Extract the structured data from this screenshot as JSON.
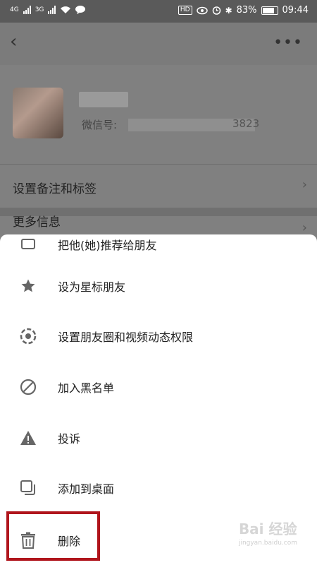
{
  "status_bar": {
    "signal1_label": "4G",
    "signal2_label": "3G",
    "hd_badge": "HD",
    "battery_percent": "83%",
    "time": "09:44"
  },
  "header": {
    "back_icon": "chevron-left-icon",
    "more_icon": "more-horizontal-icon"
  },
  "profile": {
    "wechat_id_label": "微信号:",
    "wechat_id_tail": "3823"
  },
  "rows": {
    "remark_label": "设置备注和标签",
    "partial_label": "更多信息"
  },
  "sheet": {
    "clipped_item": "把他(她)推荐给朋友",
    "items": [
      {
        "label": "设为星标朋友",
        "icon": "star-icon"
      },
      {
        "label": "设置朋友圈和视频动态权限",
        "icon": "shutter-icon"
      },
      {
        "label": "加入黑名单",
        "icon": "block-icon"
      },
      {
        "label": "投诉",
        "icon": "warning-icon"
      },
      {
        "label": "添加到桌面",
        "icon": "desktop-add-icon"
      },
      {
        "label": "删除",
        "icon": "trash-icon"
      }
    ]
  },
  "watermark": {
    "text": "Bai 经验",
    "url": "jingyan.baidu.com"
  },
  "colors": {
    "highlight": "#b0151c"
  }
}
